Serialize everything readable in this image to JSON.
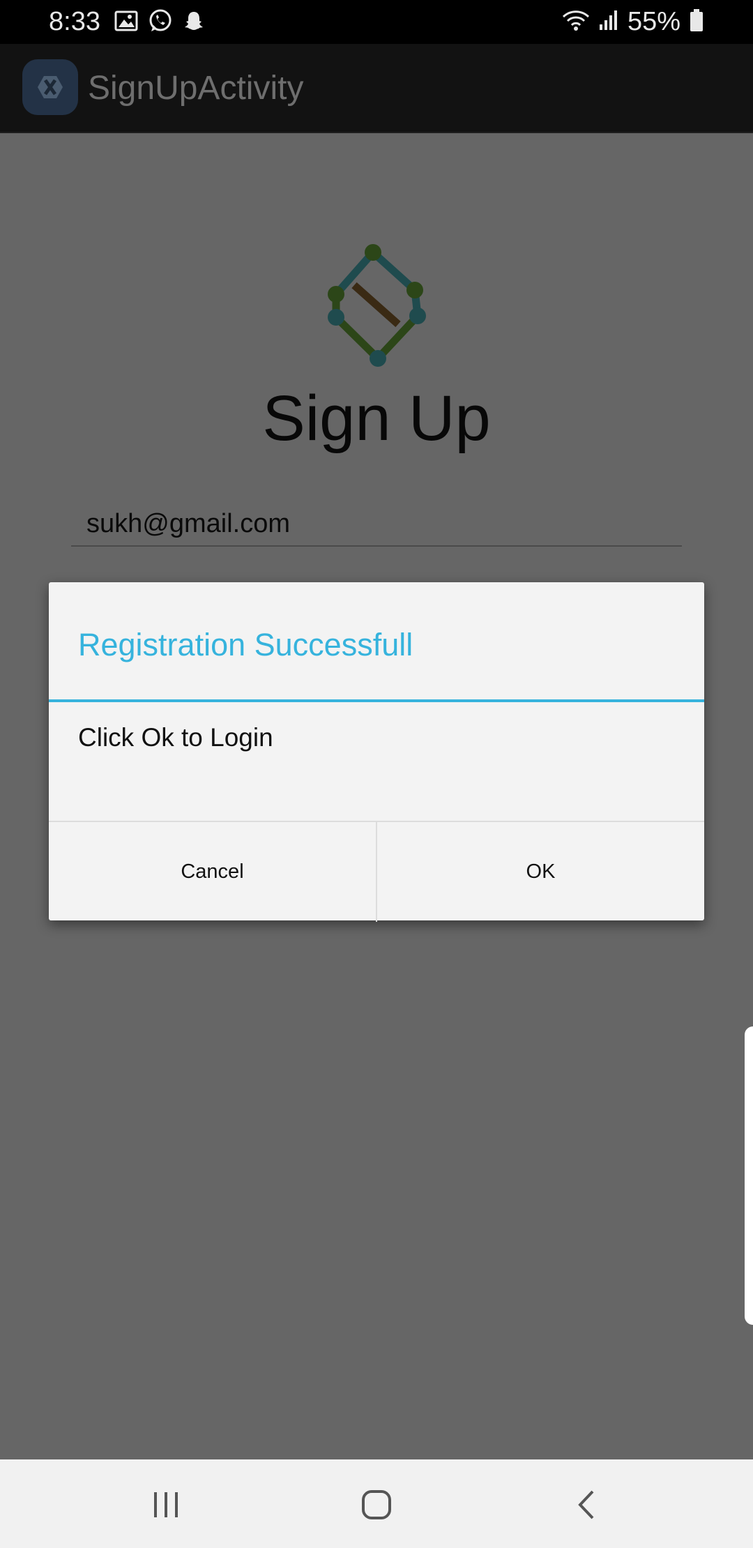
{
  "status_bar": {
    "time": "8:33",
    "battery_percent": "55%",
    "left_icons": [
      "image-icon",
      "whatsapp-icon",
      "snapchat-icon"
    ],
    "right_icons": [
      "wifi-icon",
      "signal-icon",
      "battery-icon"
    ]
  },
  "app_bar": {
    "title": "SignUpActivity",
    "logo_icon": "xamarin-logo-icon"
  },
  "page": {
    "heading": "Sign Up",
    "email_value": "sukh@gmail.com",
    "logo_icon": "diamond-nodes-logo-icon"
  },
  "dialog": {
    "title": "Registration Successfull",
    "message": "Click Ok to Login",
    "cancel_label": "Cancel",
    "ok_label": "OK"
  },
  "nav_bar": {
    "icons": [
      "recent-apps-icon",
      "home-icon",
      "back-icon"
    ]
  },
  "colors": {
    "accent": "#36b3dd",
    "scrim": "#666666",
    "status_bar": "#000000",
    "app_bar": "#121212",
    "dialog_background": "#f3f3f3"
  }
}
